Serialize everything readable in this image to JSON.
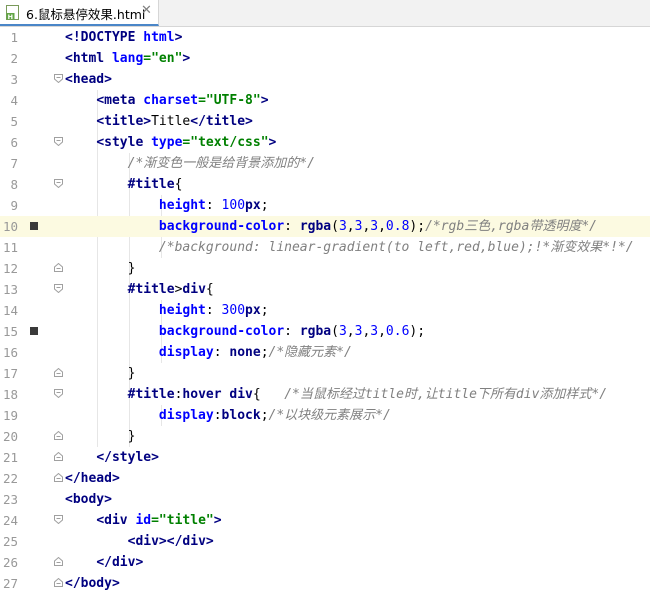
{
  "tab": {
    "label": "6.鼠标悬停效果.html",
    "close": "✕"
  },
  "colors": {
    "current_line": "#fcfae1",
    "tag": "#000080",
    "attr_name": "#0000ff",
    "attr_value": "#008000",
    "comment": "#808080"
  },
  "markers": [
    10,
    15
  ],
  "current_line": 10,
  "lines": [
    {
      "n": "1",
      "tokens": [
        [
          "tg",
          "<!DOCTYPE "
        ],
        [
          "an",
          "html"
        ],
        [
          "tg",
          ">"
        ]
      ]
    },
    {
      "n": "2",
      "tokens": [
        [
          "tg",
          "<html "
        ],
        [
          "an",
          "lang"
        ],
        [
          "av",
          "=\"en\""
        ],
        [
          "tg",
          ">"
        ]
      ]
    },
    {
      "n": "3",
      "tokens": [
        [
          "tg",
          "<head>"
        ]
      ]
    },
    {
      "n": "4",
      "tokens": [
        [
          "pl",
          "    "
        ],
        [
          "tg",
          "<meta "
        ],
        [
          "an",
          "charset"
        ],
        [
          "av",
          "=\"UTF-8\""
        ],
        [
          "tg",
          ">"
        ]
      ]
    },
    {
      "n": "5",
      "tokens": [
        [
          "pl",
          "    "
        ],
        [
          "tg",
          "<title>"
        ],
        [
          "pl",
          "Title"
        ],
        [
          "tg",
          "</title>"
        ]
      ]
    },
    {
      "n": "6",
      "tokens": [
        [
          "pl",
          "    "
        ],
        [
          "tg",
          "<style "
        ],
        [
          "an",
          "type"
        ],
        [
          "av",
          "=\"text/css\""
        ],
        [
          "tg",
          ">"
        ]
      ]
    },
    {
      "n": "7",
      "tokens": [
        [
          "pl",
          "        "
        ],
        [
          "cm",
          "/*渐变色一般是给背景添加的*/"
        ]
      ]
    },
    {
      "n": "8",
      "tokens": [
        [
          "pl",
          "        "
        ],
        [
          "sel",
          "#title"
        ],
        [
          "pl",
          "{"
        ]
      ]
    },
    {
      "n": "9",
      "tokens": [
        [
          "pl",
          "            "
        ],
        [
          "pr",
          "height"
        ],
        [
          "pl",
          ": "
        ],
        [
          "num",
          "100"
        ],
        [
          "kw",
          "px"
        ],
        [
          "pl",
          ";"
        ]
      ]
    },
    {
      "n": "10",
      "tokens": [
        [
          "pl",
          "            "
        ],
        [
          "pr",
          "background-color"
        ],
        [
          "pl",
          ": "
        ],
        [
          "fn",
          "rgba"
        ],
        [
          "pl",
          "("
        ],
        [
          "num",
          "3"
        ],
        [
          "pl",
          ","
        ],
        [
          "num",
          "3"
        ],
        [
          "pl",
          ","
        ],
        [
          "num",
          "3"
        ],
        [
          "pl",
          ","
        ],
        [
          "num",
          "0.8"
        ],
        [
          "pl",
          ");"
        ],
        [
          "cm",
          "/*rgb三色,rgba带透明度*/"
        ]
      ]
    },
    {
      "n": "11",
      "tokens": [
        [
          "pl",
          "            "
        ],
        [
          "cm",
          "/*background: linear-gradient(to left,red,blue);!*渐变效果*!*/"
        ]
      ]
    },
    {
      "n": "12",
      "tokens": [
        [
          "pl",
          "        }"
        ]
      ]
    },
    {
      "n": "13",
      "tokens": [
        [
          "pl",
          "        "
        ],
        [
          "sel",
          "#title"
        ],
        [
          "pl",
          ">"
        ],
        [
          "sel",
          "div"
        ],
        [
          "pl",
          "{"
        ]
      ]
    },
    {
      "n": "14",
      "tokens": [
        [
          "pl",
          "            "
        ],
        [
          "pr",
          "height"
        ],
        [
          "pl",
          ": "
        ],
        [
          "num",
          "300"
        ],
        [
          "kw",
          "px"
        ],
        [
          "pl",
          ";"
        ]
      ]
    },
    {
      "n": "15",
      "tokens": [
        [
          "pl",
          "            "
        ],
        [
          "pr",
          "background-color"
        ],
        [
          "pl",
          ": "
        ],
        [
          "fn",
          "rgba"
        ],
        [
          "pl",
          "("
        ],
        [
          "num",
          "3"
        ],
        [
          "pl",
          ","
        ],
        [
          "num",
          "3"
        ],
        [
          "pl",
          ","
        ],
        [
          "num",
          "3"
        ],
        [
          "pl",
          ","
        ],
        [
          "num",
          "0.6"
        ],
        [
          "pl",
          ");"
        ]
      ]
    },
    {
      "n": "16",
      "tokens": [
        [
          "pl",
          "            "
        ],
        [
          "pr",
          "display"
        ],
        [
          "pl",
          ": "
        ],
        [
          "kw",
          "none"
        ],
        [
          "pl",
          ";"
        ],
        [
          "cm",
          "/*隐藏元素*/"
        ]
      ]
    },
    {
      "n": "17",
      "tokens": [
        [
          "pl",
          "        }"
        ]
      ]
    },
    {
      "n": "18",
      "tokens": [
        [
          "pl",
          "        "
        ],
        [
          "sel",
          "#title"
        ],
        [
          "pl",
          ":"
        ],
        [
          "sel",
          "hover div"
        ],
        [
          "pl",
          "{   "
        ],
        [
          "cm",
          "/*当鼠标经过title时,让title下所有div添加样式*/"
        ]
      ]
    },
    {
      "n": "19",
      "tokens": [
        [
          "pl",
          "            "
        ],
        [
          "pr",
          "display"
        ],
        [
          "pl",
          ":"
        ],
        [
          "kw",
          "block"
        ],
        [
          "pl",
          ";"
        ],
        [
          "cm",
          "/*以块级元素展示*/"
        ]
      ]
    },
    {
      "n": "20",
      "tokens": [
        [
          "pl",
          "        }"
        ]
      ]
    },
    {
      "n": "21",
      "tokens": [
        [
          "pl",
          "    "
        ],
        [
          "tg",
          "</style>"
        ]
      ]
    },
    {
      "n": "22",
      "tokens": [
        [
          "tg",
          "</head>"
        ]
      ]
    },
    {
      "n": "23",
      "tokens": [
        [
          "tg",
          "<body>"
        ]
      ]
    },
    {
      "n": "24",
      "tokens": [
        [
          "pl",
          "    "
        ],
        [
          "tg",
          "<div "
        ],
        [
          "an",
          "id"
        ],
        [
          "av",
          "=\"title\""
        ],
        [
          "tg",
          ">"
        ]
      ]
    },
    {
      "n": "25",
      "tokens": [
        [
          "pl",
          "        "
        ],
        [
          "tg",
          "<div></div>"
        ]
      ]
    },
    {
      "n": "26",
      "tokens": [
        [
          "pl",
          "    "
        ],
        [
          "tg",
          "</div>"
        ]
      ]
    },
    {
      "n": "27",
      "tokens": [
        [
          "tg",
          "</body>"
        ]
      ]
    }
  ]
}
